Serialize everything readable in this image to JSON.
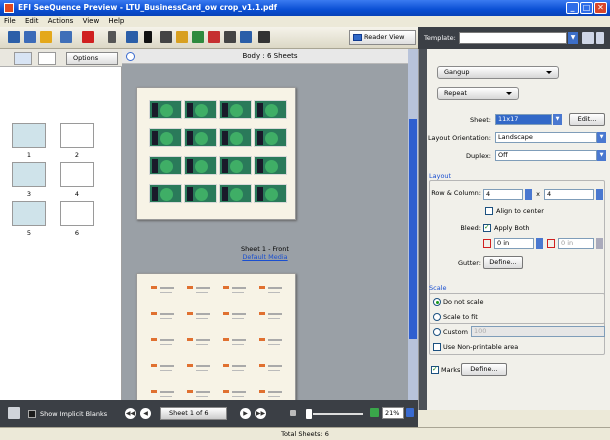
{
  "window": {
    "title": "EFI SeeQuence Preview - LTU_BusinessCard_ow crop_v1.1.pdf",
    "minimize": "_",
    "maximize": "□",
    "close": "✕"
  },
  "menu": [
    "File",
    "Edit",
    "Actions",
    "View",
    "Help"
  ],
  "toolbar": {
    "reader_view": "Reader View",
    "template_label": "Template:",
    "template_value": ""
  },
  "left_panel": {
    "options_label": "Options",
    "thumbnails": [
      {
        "num": "1",
        "kind": "front"
      },
      {
        "num": "2",
        "kind": "back"
      },
      {
        "num": "3",
        "kind": "front"
      },
      {
        "num": "4",
        "kind": "back"
      },
      {
        "num": "5",
        "kind": "front"
      },
      {
        "num": "6",
        "kind": "back"
      }
    ]
  },
  "bottom": {
    "show_implicit_blanks": "Show Implicit Blanks",
    "page_select": "Sheet 1 of 6",
    "zoom": "21%"
  },
  "center": {
    "header": "Body : 6 Sheets",
    "sheet_caption": "Sheet 1 - Front",
    "media_link": "Default Media"
  },
  "right_panel": {
    "mode": "Gangup",
    "repeat": "Repeat",
    "sheet_label": "Sheet:",
    "sheet_value": "11x17",
    "edit_button": "Edit...",
    "orientation_label": "Layout Orientation:",
    "orientation_value": "Landscape",
    "duplex_label": "Duplex:",
    "duplex_value": "Off",
    "layout_title": "Layout",
    "row_col_label": "Row & Column:",
    "rows": "4",
    "times": "x",
    "cols": "4",
    "align_center": "Align to center",
    "bleed_label": "Bleed:",
    "apply_both": "Apply Both",
    "bleed_h": "0 in",
    "bleed_v": "0 in",
    "gutter_label": "Gutter:",
    "define_button": "Define...",
    "scale_title": "Scale",
    "scale_options": [
      "Do not scale",
      "Scale to fit",
      "Custom"
    ],
    "custom_value": "100",
    "non_printable": "Use Non-printable area",
    "marks_label": "Marks",
    "marks_define": "Define..."
  },
  "status": {
    "total": "Total Sheets: 6"
  }
}
